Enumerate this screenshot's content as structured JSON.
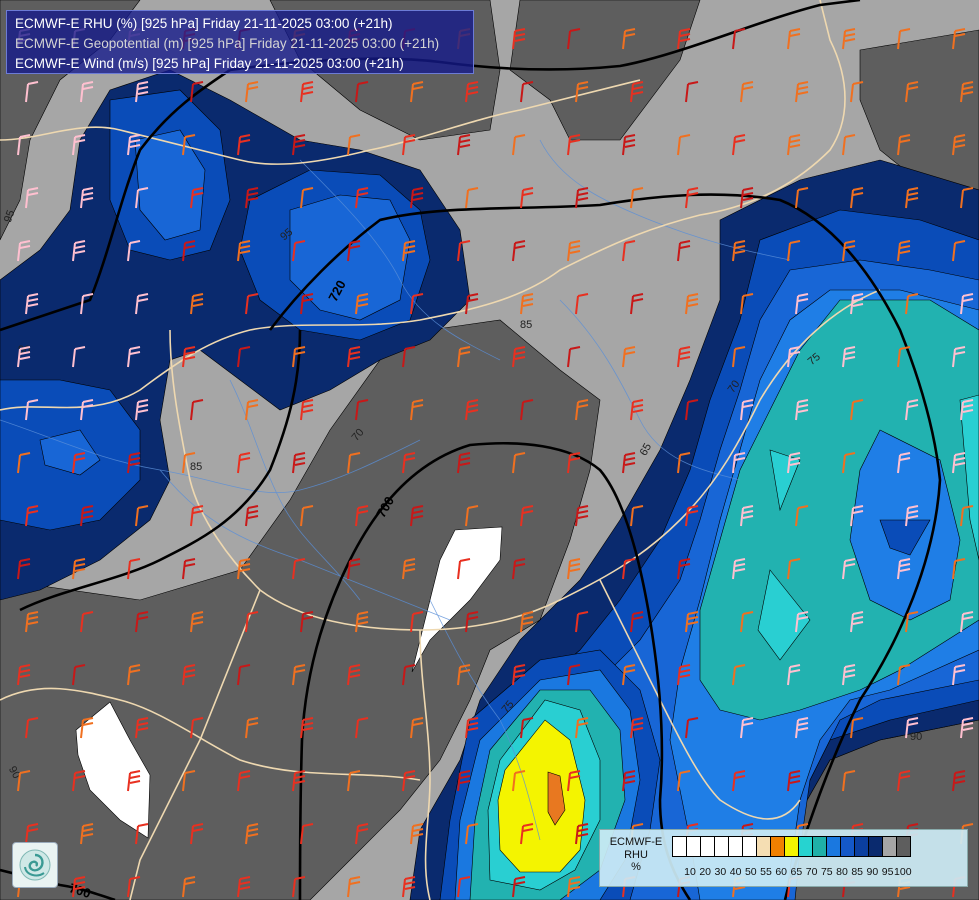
{
  "map": {
    "title_lines": [
      {
        "text": "ECMWF-E RHU (%) [925 hPa] Friday 21-11-2025 03:00 (+21h)",
        "color": "#ffffff"
      },
      {
        "text": "ECMWF-E Geopotential (m) [925 hPa] Friday 21-11-2025 03:00 (+21h)",
        "color": "#d4d4d4"
      },
      {
        "text": "ECMWF-E Wind (m/s) [925 hPa] Friday 21-11-2025 03:00 (+21h)",
        "color": "#ffffff"
      }
    ],
    "contour_labels": [
      "720",
      "700",
      "700",
      "95",
      "95",
      "90",
      "90",
      "90",
      "75",
      "75",
      "70",
      "70",
      "65",
      "85",
      "85"
    ],
    "colors": {
      "background": "#a6a6a6",
      "dark_gray": "#5e5e5e",
      "navy": "#0a2a6e",
      "blue": "#0a4cb8",
      "med_blue": "#1866d6",
      "light_blue": "#2e86e8",
      "teal": "#22b2b0",
      "cyan": "#29cfd2",
      "yellow": "#f4f400",
      "orange": "#e87820",
      "red": "#c8281a"
    }
  },
  "legend": {
    "title_lines": [
      "ECMWF-E",
      "RHU",
      "%"
    ],
    "swatch_colors": [
      "#ffffff",
      "#ffffff",
      "#ffffff",
      "#ffffff",
      "#ffffff",
      "#ffffff",
      "#f5deb3",
      "#f08000",
      "#f4f400",
      "#26d3d0",
      "#1fb0a8",
      "#1a78e0",
      "#1458c8",
      "#0b3fa0",
      "#0a2a6e",
      "#a6a6a6",
      "#5e5e5e"
    ],
    "tick_labels": [
      "10",
      "20",
      "30",
      "40",
      "50",
      "55",
      "60",
      "65",
      "70",
      "75",
      "80",
      "85",
      "90",
      "95",
      "100"
    ]
  },
  "logo": {
    "icon": "ecmwf-swirl-logo"
  }
}
